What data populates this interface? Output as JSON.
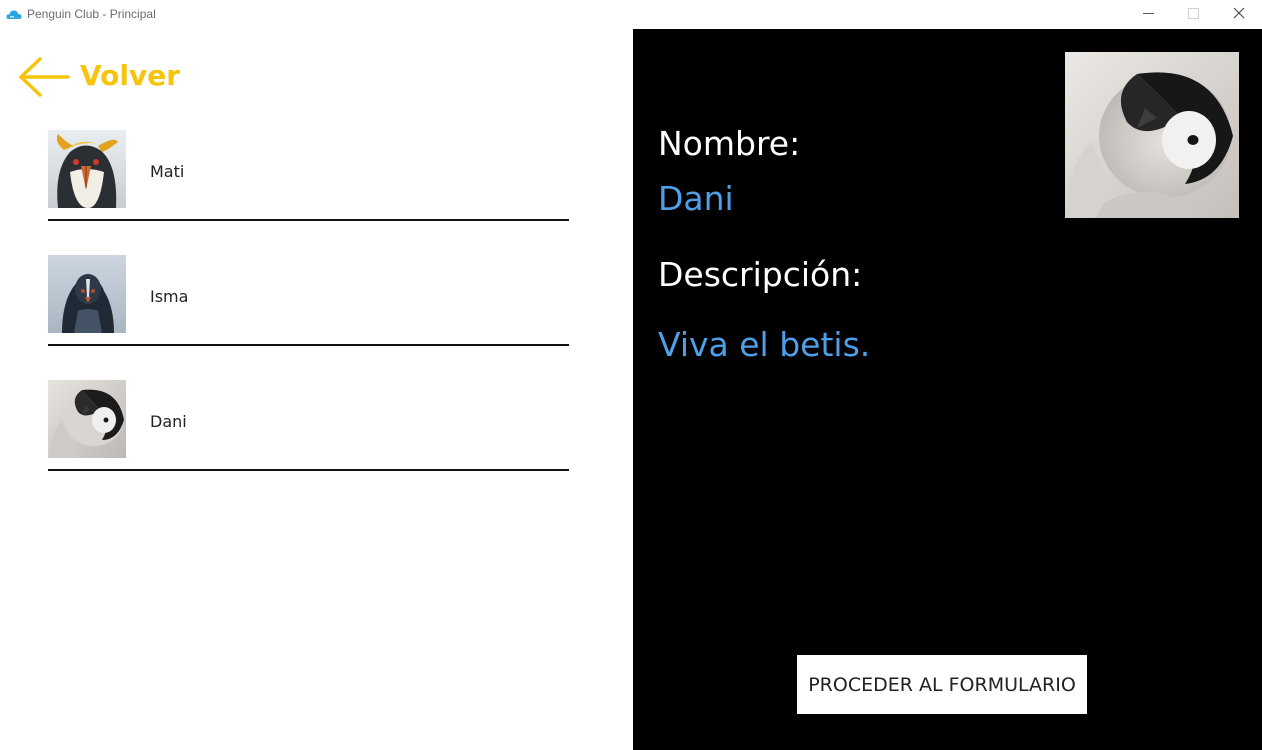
{
  "window": {
    "title": "Penguin Club - Principal",
    "icon": "cloud-icon",
    "controls": [
      "minimize-icon",
      "maximize-icon",
      "close-icon"
    ]
  },
  "back": {
    "label": "Volver",
    "icon": "arrow-left-icon",
    "color": "#f6c40b"
  },
  "penguins": [
    {
      "name": "Mati",
      "photo": "rockhopper-penguin-photo"
    },
    {
      "name": "Isma",
      "photo": "adult-penguin-photo"
    },
    {
      "name": "Dani",
      "photo": "emperor-penguin-chick-photo"
    }
  ],
  "detail": {
    "name_label": "Nombre:",
    "name_value": "Dani",
    "description_label": "Descripción:",
    "description_value": "Viva el betis.",
    "photo": "emperor-penguin-chick-photo",
    "value_color": "#4f9fe8",
    "background": "#000000"
  },
  "actions": {
    "proceed_label": "PROCEDER AL FORMULARIO"
  }
}
